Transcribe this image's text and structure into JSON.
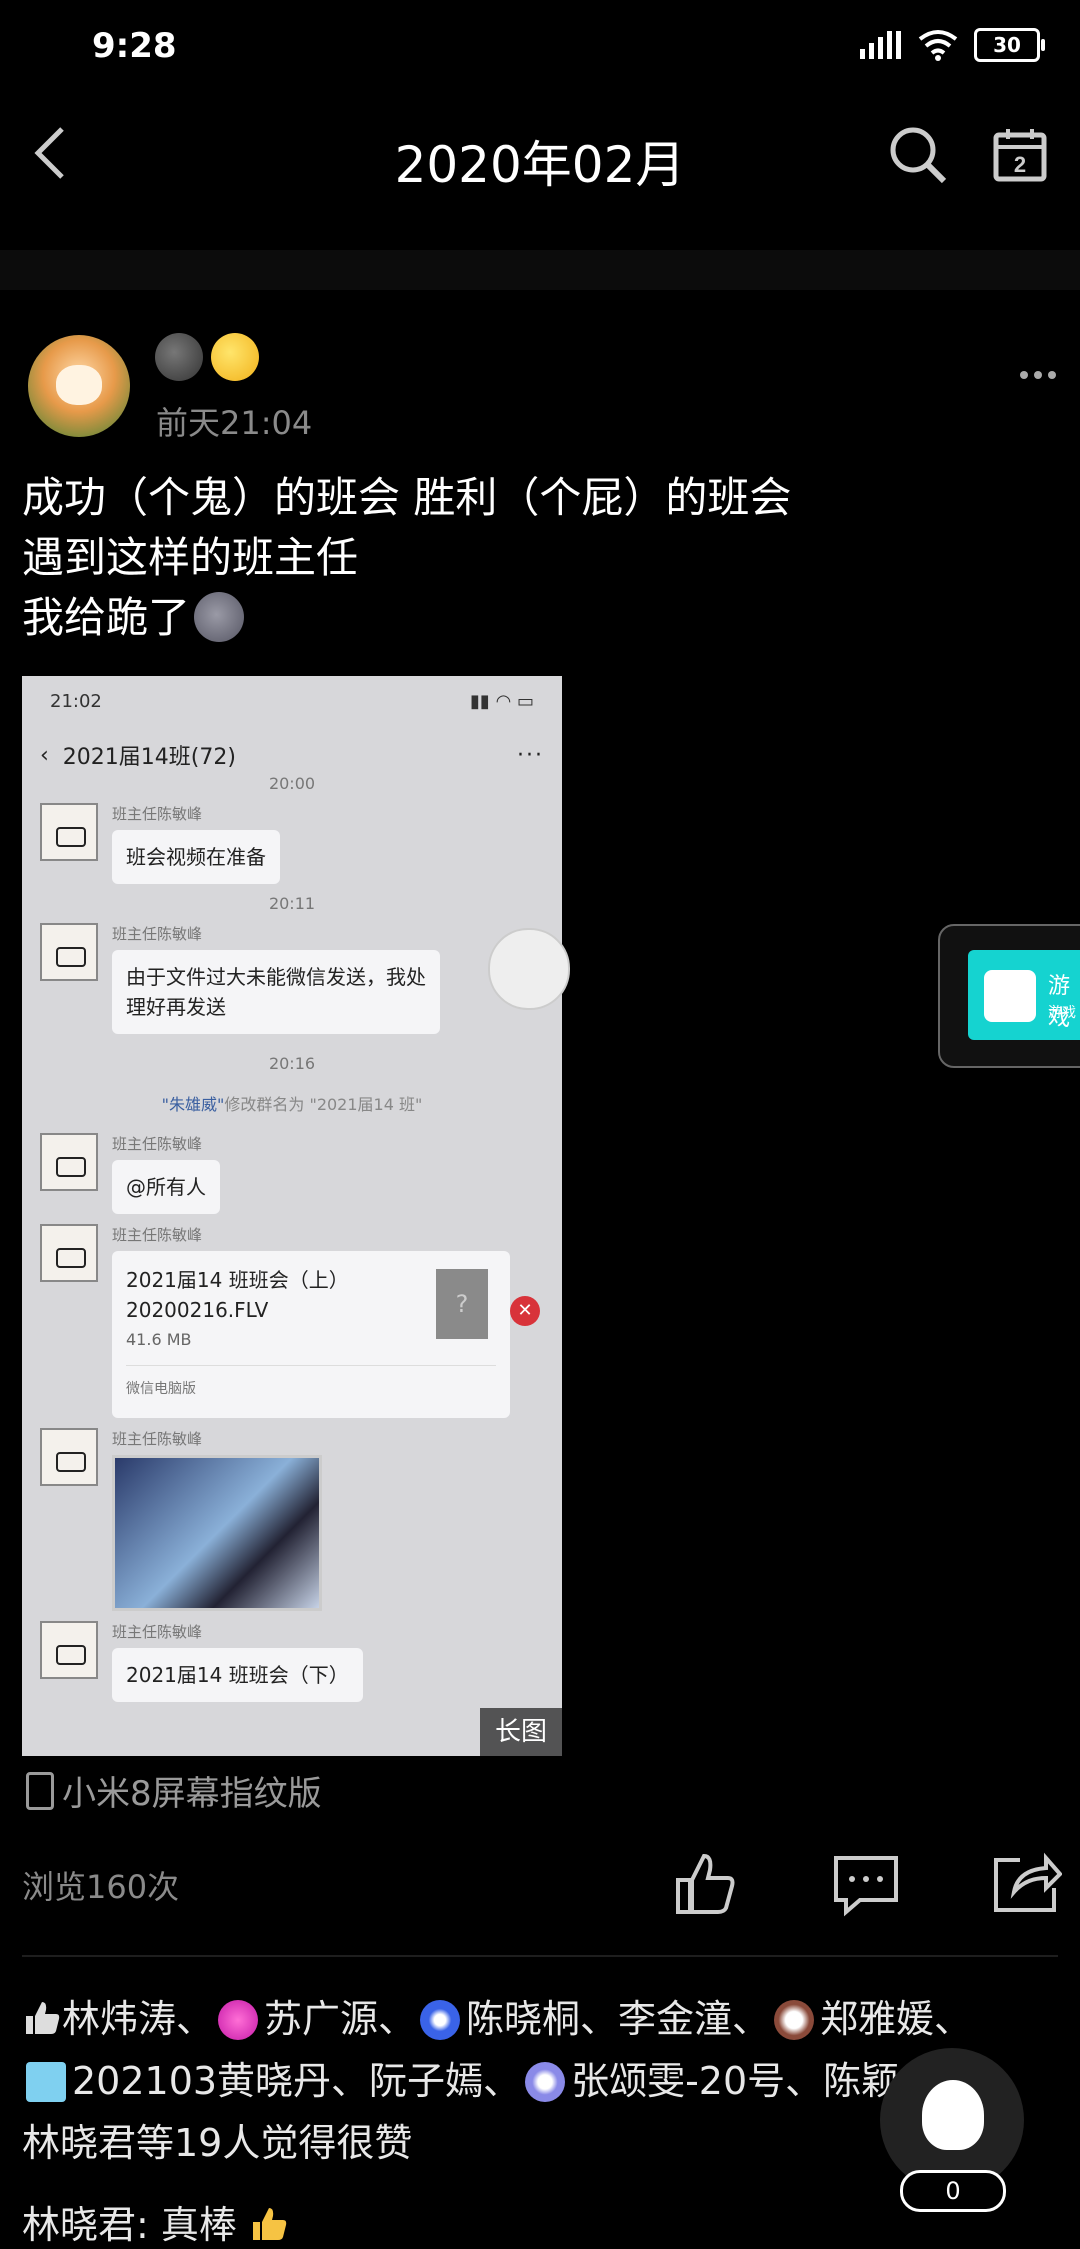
{
  "status_bar": {
    "time": "9:28",
    "battery": "30"
  },
  "header": {
    "title": "2020年02月"
  },
  "post": {
    "time": "前天21:04",
    "text_lines": [
      "成功（个鬼）的班会 胜利（个屁）的班会",
      "遇到这样的班主任",
      "我给跪了"
    ],
    "image_badge": "长图",
    "device": "小米8屏幕指纹版",
    "views": "浏览160次"
  },
  "screenshot": {
    "status_time": "21:02",
    "chat_title": "2021届14班(72)",
    "chat_more": "···",
    "time_top": "20:00",
    "sender": "班主任陈敏峰",
    "msg1": "班会视频在准备",
    "time2": "20:11",
    "msg2_line1": "由于文件过大未能微信发送，我处",
    "msg2_line2": "理好再发送",
    "time3": "20:16",
    "notice_name": "\"朱雄威\"",
    "notice_rest": "修改群名为 \"2021届14 班\"",
    "msg3": "@所有人",
    "file_name_1": "2021届14 班班会（上）",
    "file_name_2": "20200216.FLV",
    "file_size": "41.6 MB",
    "file_source": "微信电脑版",
    "file_icon_text": "?",
    "msg_last": "2021届14 班班会（下）"
  },
  "game_card": {
    "title": "游戏",
    "subtitle": "游戏"
  },
  "likes": {
    "names_1": "林炜涛、",
    "names_2": "苏广源、",
    "names_3": "陈晓桐、李金潼、",
    "names_4": "郑雅媛、",
    "names_5": "202103黄晓丹、阮子嫣、",
    "names_6": "张颂雯-20号、陈颖",
    "summary": "林晓君等19人觉得很赞"
  },
  "comment": {
    "author": "林晓君",
    "text": ": 真棒"
  },
  "fab": {
    "count": "0"
  }
}
